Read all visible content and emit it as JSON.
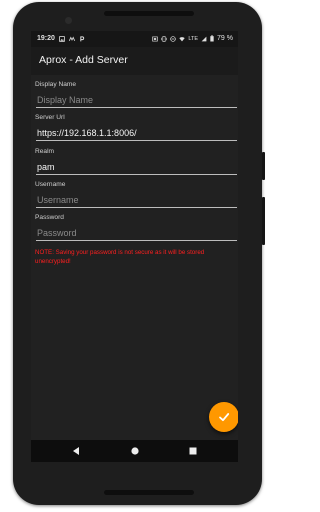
{
  "statusbar": {
    "time": "19:20",
    "network": "LTE",
    "battery": "79 %",
    "left_icons": [
      "image-icon",
      "autoplay-icon",
      "p-icon"
    ],
    "right_icons": [
      "cast-icon",
      "vibrate-icon",
      "dnd-icon",
      "wifi-icon",
      "signal-icon",
      "battery-icon"
    ]
  },
  "appbar": {
    "title": "Aprox - Add Server"
  },
  "form": {
    "display_name": {
      "label": "Display Name",
      "value": "",
      "placeholder": "Display Name"
    },
    "server_url": {
      "label": "Server Url",
      "value": "https://192.168.1.1:8006/",
      "placeholder": ""
    },
    "realm": {
      "label": "Realm",
      "value": "pam",
      "placeholder": ""
    },
    "username": {
      "label": "Username",
      "value": "",
      "placeholder": "Username"
    },
    "password": {
      "label": "Password",
      "value": "",
      "placeholder": "Password"
    }
  },
  "note": "NOTE: Saving your password is not secure as it will be stored unencrypted!",
  "fab": {
    "icon": "check-icon",
    "color": "#ff9800"
  },
  "navbar": {
    "icons": [
      "back-icon",
      "home-icon",
      "recents-icon"
    ]
  },
  "colors": {
    "accent": "#ff9800",
    "warning": "#ff1f1f",
    "background": "#212121"
  }
}
